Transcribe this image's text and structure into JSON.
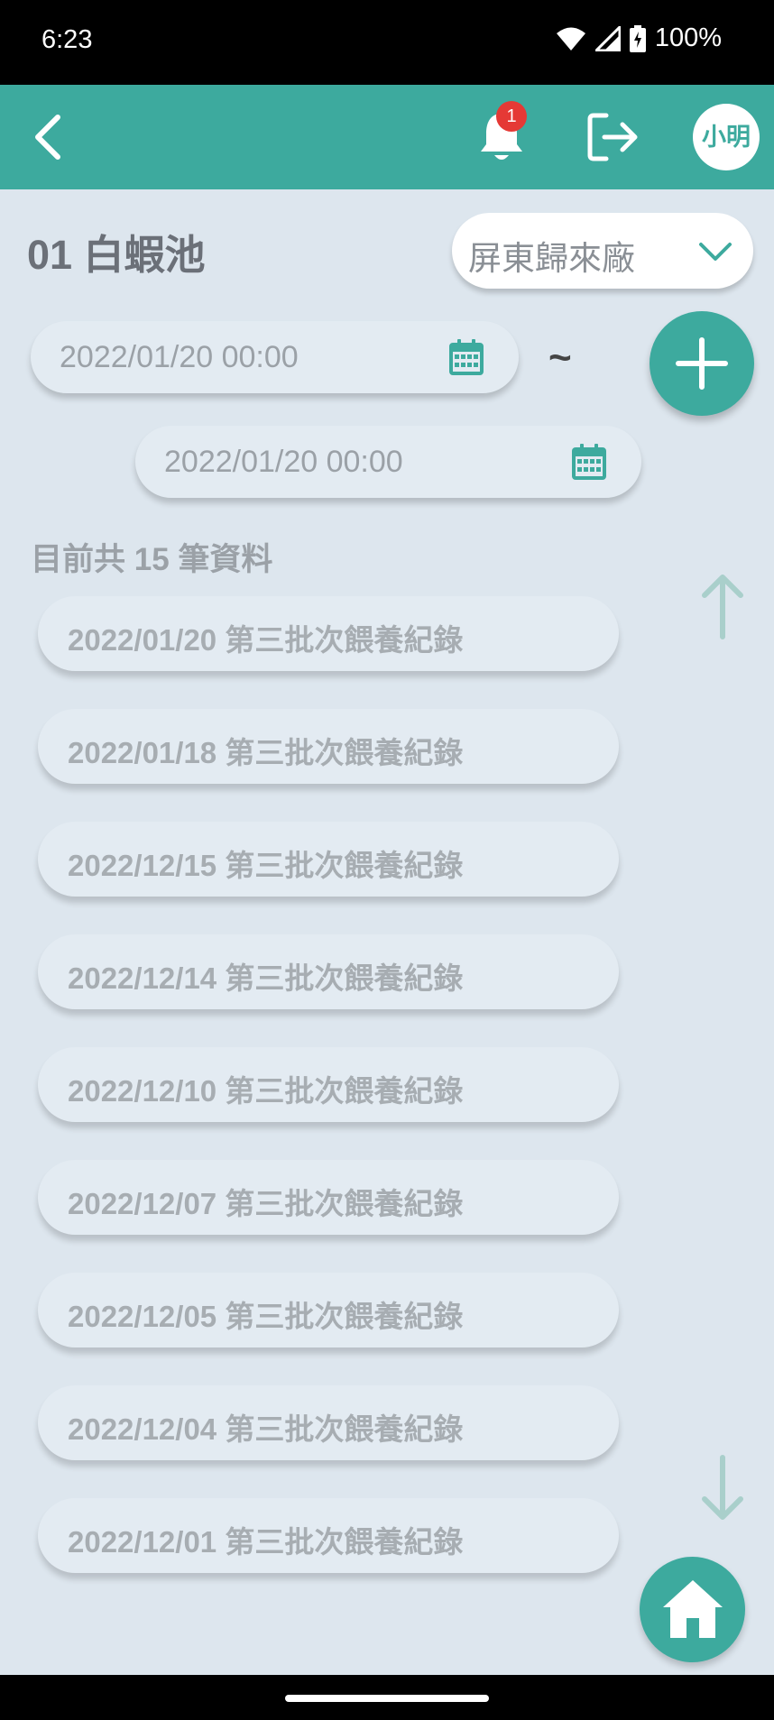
{
  "status_bar": {
    "time": "6:23",
    "battery": "100%",
    "icons": [
      "wifi-icon",
      "cellular-signal-icon",
      "battery-charging-icon"
    ]
  },
  "app_bar": {
    "notification_count": "1",
    "user_name": "小明",
    "accent_color": "#3daa9e",
    "badge_color": "#e53935"
  },
  "page": {
    "title": "01 白蝦池",
    "factory": "屏東歸來廠"
  },
  "date_range": {
    "start": "2022/01/20 00:00",
    "end": "2022/01/20 00:00",
    "separator": "~"
  },
  "records": {
    "count_label": "目前共 15 筆資料",
    "items": [
      {
        "label": "2022/01/20 第三批次餵養紀錄"
      },
      {
        "label": "2022/01/18 第三批次餵養紀錄"
      },
      {
        "label": "2022/12/15 第三批次餵養紀錄"
      },
      {
        "label": "2022/12/14 第三批次餵養紀錄"
      },
      {
        "label": "2022/12/10 第三批次餵養紀錄"
      },
      {
        "label": "2022/12/07 第三批次餵養紀錄"
      },
      {
        "label": "2022/12/05 第三批次餵養紀錄"
      },
      {
        "label": "2022/12/04 第三批次餵養紀錄"
      },
      {
        "label": "2022/12/01 第三批次餵養紀錄"
      }
    ]
  }
}
